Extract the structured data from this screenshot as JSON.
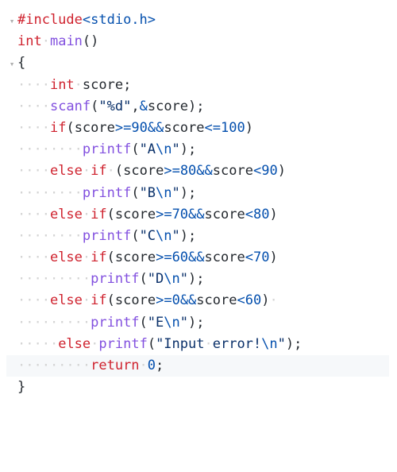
{
  "gutter": {
    "fold": "▾",
    "none": ""
  },
  "ws": {
    "dot": "·"
  },
  "l1": {
    "pp": "#include",
    "inc": "<stdio.h>"
  },
  "l2": {
    "t": "int",
    "sp": "·",
    "fn": "main",
    "p": "()"
  },
  "l3": {
    "b": "{"
  },
  "l4": {
    "ind": "····",
    "t": "int",
    "sp": "·",
    "v": "score",
    "sc": ";"
  },
  "l5": {
    "ind": "····",
    "fn": "scanf",
    "lp": "(",
    "s": "\"%d\"",
    "c": ",",
    "amp": "&",
    "v": "score",
    "rp": ")",
    "sc": ";"
  },
  "l6": {
    "ind": "····",
    "kw": "if",
    "lp": "(",
    "v1": "score",
    "op1": ">=",
    "n1": "90",
    "and": "&&",
    "v2": "score",
    "op2": "<=",
    "n2": "100",
    "rp": ")"
  },
  "l7": {
    "ind": "········",
    "fn": "printf",
    "lp": "(",
    "q1": "\"A",
    "esc": "\\n",
    "q2": "\"",
    "rp": ")",
    "sc": ";"
  },
  "l8": {
    "ind": "····",
    "kw1": "else",
    "sp1": "·",
    "kw2": "if",
    "sp2": "·",
    "lp": "(",
    "v1": "score",
    "op1": ">=",
    "n1": "80",
    "and": "&&",
    "v2": "score",
    "op2": "<",
    "n2": "90",
    "rp": ")"
  },
  "l9": {
    "ind": "········",
    "fn": "printf",
    "lp": "(",
    "q1": "\"B",
    "esc": "\\n",
    "q2": "\"",
    "rp": ")",
    "sc": ";"
  },
  "l10": {
    "ind": "····",
    "kw1": "else",
    "sp": "·",
    "kw2": "if",
    "lp": "(",
    "v1": "score",
    "op1": ">=",
    "n1": "70",
    "and": "&&",
    "v2": "score",
    "op2": "<",
    "n2": "80",
    "rp": ")"
  },
  "l11": {
    "ind": "········",
    "fn": "printf",
    "lp": "(",
    "q1": "\"C",
    "esc": "\\n",
    "q2": "\"",
    "rp": ")",
    "sc": ";"
  },
  "l12": {
    "ind": "····",
    "kw1": "else",
    "sp": "·",
    "kw2": "if",
    "lp": "(",
    "v1": "score",
    "op1": ">=",
    "n1": "60",
    "and": "&&",
    "v2": "score",
    "op2": "<",
    "n2": "70",
    "rp": ")"
  },
  "l13": {
    "ind": "·········",
    "fn": "printf",
    "lp": "(",
    "q1": "\"D",
    "esc": "\\n",
    "q2": "\"",
    "rp": ")",
    "sc": ";"
  },
  "l14": {
    "ind": "····",
    "kw1": "else",
    "sp": "·",
    "kw2": "if",
    "lp": "(",
    "v1": "score",
    "op1": ">=",
    "n1": "0",
    "and": "&&",
    "v2": "score",
    "op2": "<",
    "n2": "60",
    "rp": ")",
    "trail": "·"
  },
  "l15": {
    "ind": "·········",
    "fn": "printf",
    "lp": "(",
    "q1": "\"E",
    "esc": "\\n",
    "q2": "\"",
    "rp": ")",
    "sc": ";"
  },
  "l16": {
    "ind": "·····",
    "kw": "else",
    "sp": "·",
    "fn": "printf",
    "lp": "(",
    "q1": "\"Input",
    "sp2": "·",
    "q2": "error!",
    "esc": "\\n",
    "q3": "\"",
    "rp": ")",
    "sc": ";"
  },
  "l17": {
    "ind": "·········",
    "kw": "return",
    "sp": "·",
    "n": "0",
    "sc": ";"
  },
  "l18": {
    "b": "}"
  }
}
